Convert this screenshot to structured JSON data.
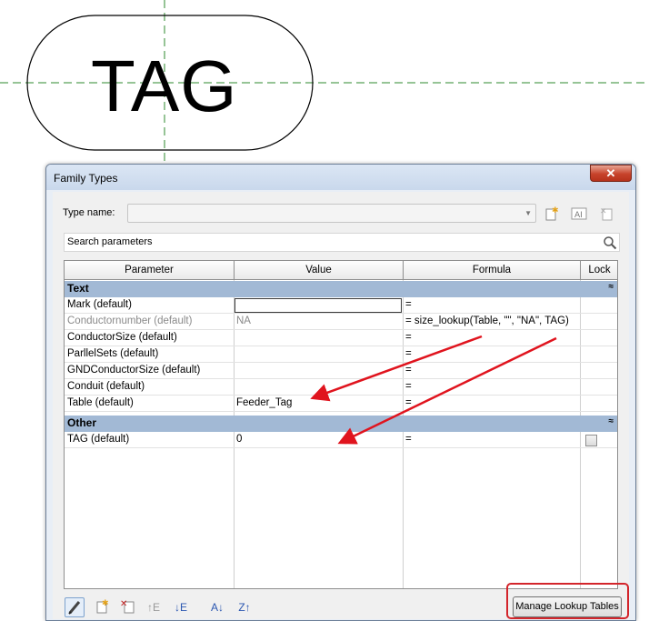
{
  "canvas": {
    "tag_label": "TAG"
  },
  "dialog": {
    "title": "Family Types",
    "close_label": "✕",
    "type_name_label": "Type name:",
    "type_name_value": "",
    "search_placeholder": "Search parameters",
    "columns": [
      "Parameter",
      "Value",
      "Formula",
      "Lock"
    ],
    "groups": [
      {
        "name": "Text",
        "rows": [
          {
            "parameter": "Mark (default)",
            "value": "",
            "formula": "="
          },
          {
            "parameter": "Conductornumber (default)",
            "value": "NA",
            "formula": "= size_lookup(Table, \"\", \"NA\", TAG)"
          },
          {
            "parameter": "ConductorSize (default)",
            "value": "",
            "formula": "="
          },
          {
            "parameter": "ParllelSets (default)",
            "value": "",
            "formula": "="
          },
          {
            "parameter": "GNDConductorSize (default)",
            "value": "",
            "formula": "="
          },
          {
            "parameter": "Conduit (default)",
            "value": "",
            "formula": "="
          },
          {
            "parameter": "Table (default)",
            "value": "Feeder_Tag",
            "formula": "="
          }
        ]
      },
      {
        "name": "Other",
        "rows": [
          {
            "parameter": "TAG (default)",
            "value": "0",
            "formula": "=",
            "lock": false
          }
        ]
      }
    ],
    "manage_button_label": "Manage Lookup Tables"
  },
  "colors": {
    "group_header": "#a2b9d5",
    "highlight_red": "#d3252b",
    "arrow_red": "#e0141e"
  }
}
